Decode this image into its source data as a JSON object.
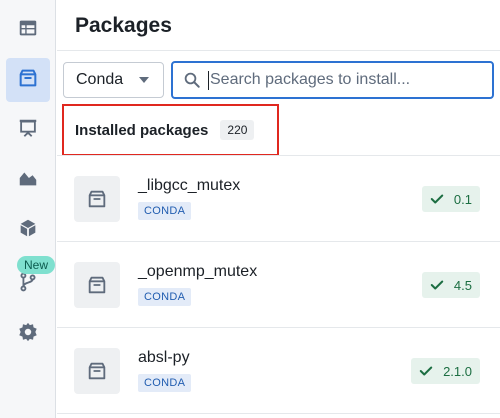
{
  "sidebar": {
    "items": [
      {
        "icon": "table-icon"
      },
      {
        "icon": "package-icon",
        "active": true
      },
      {
        "icon": "presentation-icon"
      },
      {
        "icon": "area-chart-icon"
      },
      {
        "icon": "cube-icon"
      },
      {
        "icon": "git-branch-icon",
        "badge": "New"
      },
      {
        "icon": "gear-icon"
      }
    ],
    "new_badge": "New"
  },
  "header": {
    "title": "Packages"
  },
  "toolbar": {
    "source_select": "Conda",
    "search_placeholder": "Search packages to install..."
  },
  "installed": {
    "label": "Installed packages",
    "count": "220"
  },
  "packages": [
    {
      "name": "_libgcc_mutex",
      "channel": "CONDA",
      "version": "0.1"
    },
    {
      "name": "_openmp_mutex",
      "channel": "CONDA",
      "version": "4.5"
    },
    {
      "name": "absl-py",
      "channel": "CONDA",
      "version": "2.1.0"
    }
  ],
  "colors": {
    "accent": "#2d72d2",
    "active_nav_bg": "#d3e1f7",
    "highlight_border": "#e0281f",
    "version_bg": "#e6f2ec",
    "version_text": "#1c6e42",
    "tag_bg": "#e3ebf8",
    "tag_text": "#215db0",
    "badge_bg": "#7fe0cf"
  }
}
